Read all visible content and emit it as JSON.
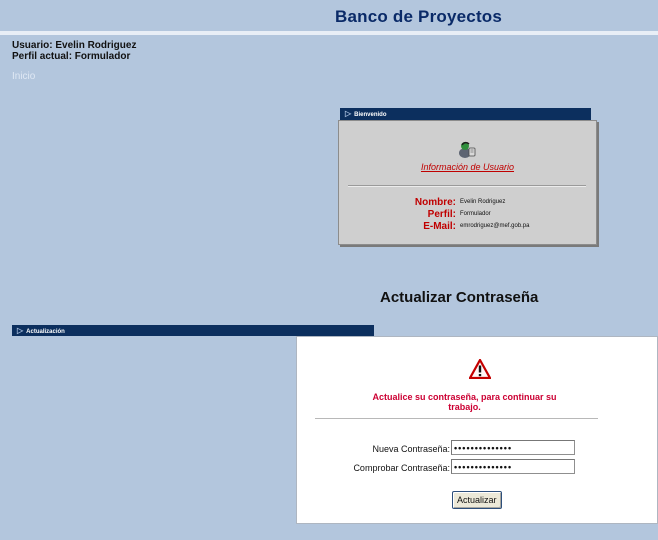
{
  "header": {
    "title": "Banco de Proyectos"
  },
  "session": {
    "user_line": "Usuario:  Evelin Rodriguez",
    "profile_line": "Perfil actual: Formulador",
    "home_link": "Inicio"
  },
  "welcome": {
    "bar_label": "Bienvenido",
    "card_title": "Información de Usuario",
    "fields": [
      {
        "label": "Nombre:",
        "value": "Evelin Rodriguez"
      },
      {
        "label": "Perfil:",
        "value": "Formulador"
      },
      {
        "label": "E-Mail:",
        "value": "emrodriguez@mef.gob.pa"
      }
    ]
  },
  "update": {
    "page_title": "Actualizar Contraseña",
    "bar_label": "Actualización",
    "warning_line1": "Actualice su contraseña,  para continuar su",
    "warning_line2": "trabajo.",
    "new_password_label": "Nueva Contraseña:",
    "new_password_value": "••••••••••••••",
    "confirm_password_label": "Comprobar Contraseña:",
    "confirm_password_value": "••••••••••••••",
    "button_label": "Actualizar"
  },
  "colors": {
    "background": "#b3c6dd",
    "header_text": "#0a2a68",
    "section_bar": "#0c2f5e",
    "accent_red": "#c00000",
    "warning_red": "#cc0033"
  },
  "icons": {
    "user_card_icon": "user-info-icon",
    "warning_icon": "warning-triangle-icon",
    "bar_icon": "triangle-arrow-icon"
  }
}
